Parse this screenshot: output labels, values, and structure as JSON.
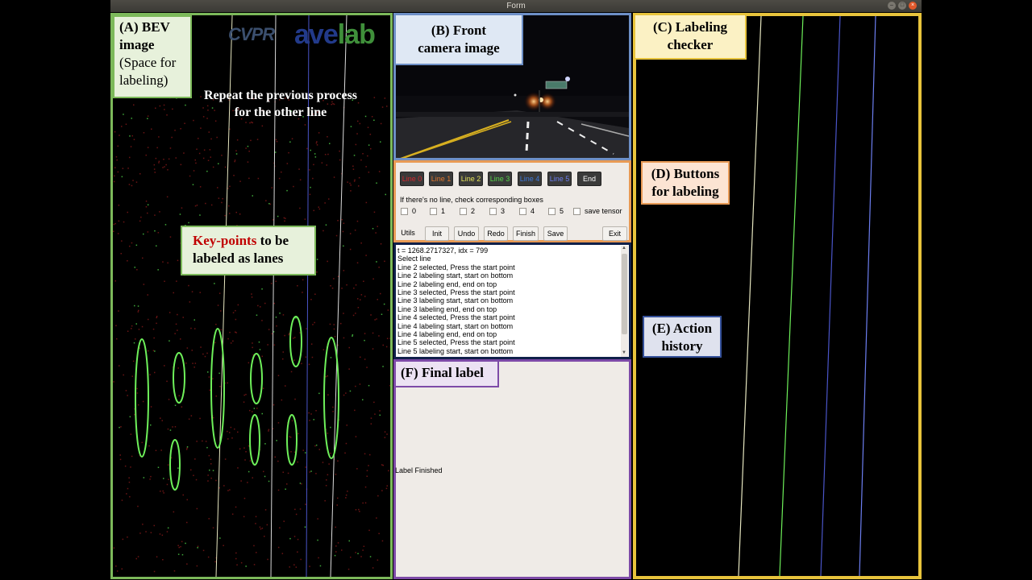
{
  "window": {
    "title": "Form"
  },
  "labels": {
    "A_line1": "(A) BEV",
    "A_line2": "image",
    "A_line3": "(Space for",
    "A_line4": "labeling)",
    "B_line1": "(B) Front",
    "B_line2": "camera image",
    "C_line1": "(C) Labeling",
    "C_line2": "checker",
    "D_line1": "(D) Buttons",
    "D_line2": "for labeling",
    "E_line1": "(E) Action",
    "E_line2": "history",
    "F": "(F) Final label"
  },
  "annotations": {
    "repeat_line1": "Repeat the previous process",
    "repeat_line2": "for the other line",
    "keypoints_red": "Key-points",
    "keypoints_rest1": " to be",
    "keypoints_line2": "labeled as lanes"
  },
  "logo": {
    "cvpr": "CVPR",
    "ave": "ave",
    "lab": "lab"
  },
  "line_buttons": [
    {
      "label": "Line 0",
      "color": "#d3282e"
    },
    {
      "label": "Line 1",
      "color": "#e0772f"
    },
    {
      "label": "Line 2",
      "color": "#e6e35a"
    },
    {
      "label": "Line 3",
      "color": "#56d44a"
    },
    {
      "label": "Line 4",
      "color": "#3f78d8"
    },
    {
      "label": "Line 5",
      "color": "#6c7ef0"
    },
    {
      "label": "End",
      "color": "#ffffff"
    }
  ],
  "hint": "If there's no line, check corresponding boxes",
  "checkboxes": [
    "0",
    "1",
    "2",
    "3",
    "4",
    "5",
    "save tensor"
  ],
  "action_buttons": [
    "Utils",
    "Init",
    "Undo",
    "Redo",
    "Finish",
    "Save",
    "Exit"
  ],
  "history": [
    "t = 1268.2717327, idx = 799",
    "Select line",
    "Line 2 selected, Press the start point",
    "Line 2 labeling start, start on bottom",
    "Line 2 labeling end, end on top",
    "Line 3 selected, Press the start point",
    "Line 3 labeling start, start on bottom",
    "Line 3 labeling end, end on top",
    "Line 4 selected, Press the start point",
    "Line 4 labeling start, start on bottom",
    "Line 4 labeling end, end on top",
    "Line 5 selected, Press the start point",
    "Line 5 labeling start, start on bottom"
  ],
  "final_status": "Label Finished",
  "colors": {
    "panel_A": "#7cb95a",
    "panel_B": "#6d8fc6",
    "panel_C": "#e8c43c",
    "panel_D": "#e89a55",
    "panel_E": "#10204a",
    "panel_F": "#7d4aa8",
    "keypoint_ellipse": "#6ef05a"
  }
}
